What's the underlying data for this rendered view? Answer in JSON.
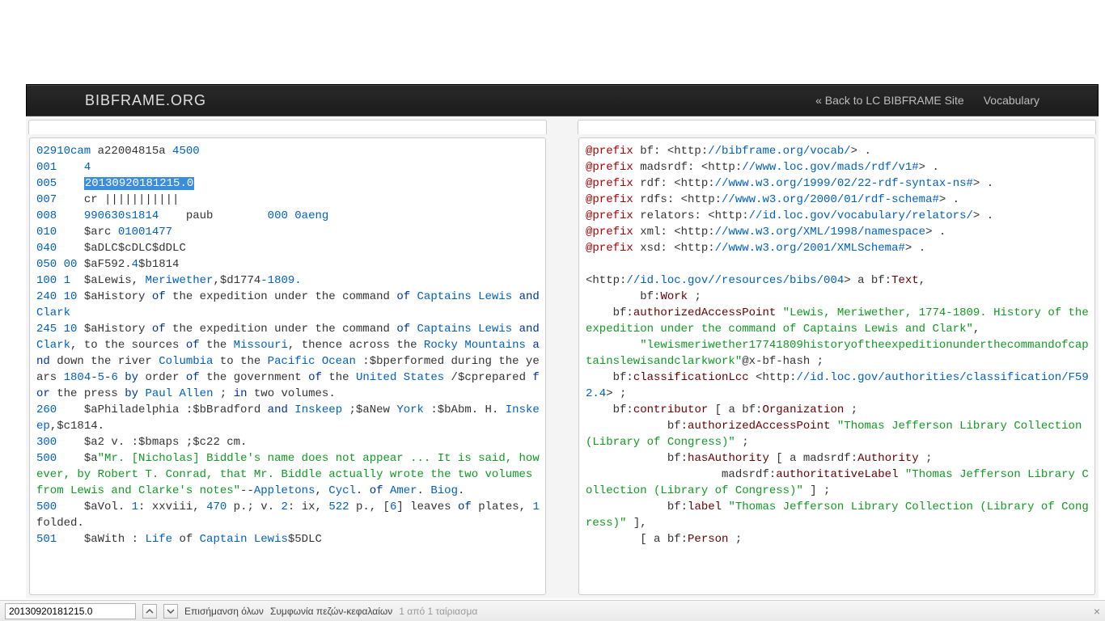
{
  "nav": {
    "brand": "BIBFRAME.ORG",
    "back_link": "« Back to LC BIBFRAME Site",
    "vocab_link": "Vocabulary"
  },
  "findbar": {
    "query": "20130920181215.0",
    "highlight_all": "Επισήμανση όλων",
    "match_case": "Συμφωνία πεζών-κεφαλαίων",
    "result_count": "1 από 1 ταίριασμα"
  },
  "marc": {
    "highlighted": "20130920181215.0",
    "lines": [
      {
        "html": "<span class='tk-blue'>02910cam</span> a22004815a <span class='tk-blue'>4500</span>"
      },
      {
        "html": "<span class='tk-blue'>001</span>    <span class='tk-blue'>4</span>"
      },
      {
        "html": "<span class='tk-blue'>005</span>    <span class='tk-sel'>20130920181215.0</span>"
      },
      {
        "html": "<span class='tk-blue'>007</span>    cr |||||||||||"
      },
      {
        "html": "<span class='tk-blue'>008</span>    <span class='tk-blue'>990630s1814</span>    paub        <span class='tk-blue'>000 0aeng</span>"
      },
      {
        "html": "<span class='tk-blue'>010</span>    $arc <span class='tk-blue'>01001477</span>"
      },
      {
        "html": "<span class='tk-blue'>040</span>    $aDLC$cDLC$dDLC"
      },
      {
        "html": "<span class='tk-blue'>050 00</span> $aF592.<span class='tk-blue'>4</span>$b1814"
      },
      {
        "html": "<span class='tk-blue'>100 1</span>  $aLewis, <span class='tk-comm'>Meriwether</span>,$d1774<span class='tk-blue'>-1809.</span>"
      },
      {
        "html": "<span class='tk-blue'>240 10</span> $aHistory <span class='tk-dblue'>of</span> the expedition under the command <span class='tk-dblue'>of</span> <span class='tk-comm'>Captains Lewis</span> <span class='tk-dblue'>and</span> <span class='tk-comm'>Clark</span>"
      },
      {
        "html": "<span class='tk-blue'>245 10</span> $aHistory <span class='tk-dblue'>of</span> the expedition under the command <span class='tk-dblue'>of</span> <span class='tk-comm'>Captains Lewis</span> <span class='tk-dblue'>and</span> <span class='tk-comm'>Clark</span>, to the sources <span class='tk-dblue'>of</span> the <span class='tk-comm'>Missouri</span>, thence across the <span class='tk-comm'>Rocky Mountains</span> <span class='tk-dblue'>and</span> down the river <span class='tk-comm'>Columbia</span> to the <span class='tk-comm'>Pacific Ocean</span> :$bperformed during the years <span class='tk-blue'>1804</span>-<span class='tk-blue'>5</span>-<span class='tk-blue'>6</span> <span class='tk-dblue'>by</span> order <span class='tk-dblue'>of</span> the government <span class='tk-dblue'>of</span> the <span class='tk-comm'>United States</span> /$cprepared <span class='tk-dblue'>for</span> the press <span class='tk-dblue'>by</span> <span class='tk-comm'>Paul Allen</span> ; <span class='tk-dblue'>in</span> two volumes."
      },
      {
        "html": "<span class='tk-blue'>260</span>    $aPhiladelphia :$bBradford <span class='tk-dblue'>and</span> <span class='tk-comm'>Inskeep</span> ;$aNew <span class='tk-comm'>York</span> :$bAbm. H. <span class='tk-comm'>Inskeep</span>,$c1814."
      },
      {
        "html": "<span class='tk-blue'>300</span>    $a2 v. :$bmaps ;$c22 cm."
      },
      {
        "html": "<span class='tk-blue'>500</span>    $a<span class='tk-green'>\"Mr. [Nicholas] Biddle's name does not appear ... It is said, however, by Robert T. Conrad, that Mr. Biddle actually wrote the two volumes from Lewis and Clarke's notes\"</span>--<span class='tk-comm'>Appletons</span>, <span class='tk-comm'>Cycl</span>. <span class='tk-dblue'>of</span> <span class='tk-comm'>Amer</span>. <span class='tk-comm'>Biog</span>."
      },
      {
        "html": "<span class='tk-blue'>500</span>    $aVol. <span class='tk-blue'>1</span>: xxviii, <span class='tk-blue'>470</span> p.; v. <span class='tk-blue'>2</span>: ix, <span class='tk-blue'>522</span> p., [<span class='tk-blue'>6</span>] leaves <span class='tk-dblue'>of</span> plates, <span class='tk-blue'>1</span> folded."
      },
      {
        "html": "<span class='tk-blue'>501</span>    $aWith : <span class='tk-comm'>Life</span> of <span class='tk-comm'>Captain Lewis</span>$5DLC"
      }
    ]
  },
  "turtle": {
    "lines": [
      {
        "html": "<span class='tk-red'>@prefix</span> bf: &lt;http:<span class='tk-blue'>//bibframe.org/vocab/</span>&gt; ."
      },
      {
        "html": "<span class='tk-red'>@prefix</span> madsrdf: &lt;http:<span class='tk-blue'>//www.loc.gov/mads/rdf/v1#</span>&gt; ."
      },
      {
        "html": "<span class='tk-red'>@prefix</span> rdf: &lt;http:<span class='tk-blue'>//www.w3.org/1999/02/22-rdf-syntax-ns#</span>&gt; ."
      },
      {
        "html": "<span class='tk-red'>@prefix</span> rdfs: &lt;http:<span class='tk-blue'>//www.w3.org/2000/01/rdf-schema#</span>&gt; ."
      },
      {
        "html": "<span class='tk-red'>@prefix</span> relators: &lt;http:<span class='tk-blue'>//id.loc.gov/vocabulary/relators/</span>&gt; ."
      },
      {
        "html": "<span class='tk-red'>@prefix</span> xml: &lt;http:<span class='tk-blue'>//www.w3.org/XML/1998/namespace</span>&gt; ."
      },
      {
        "html": "<span class='tk-red'>@prefix</span> xsd: &lt;http:<span class='tk-blue'>//www.w3.org/2001/XMLSchema#</span>&gt; ."
      },
      {
        "html": ""
      },
      {
        "html": "&lt;http:<span class='tk-blue'>//id.loc.gov//resources/bibs/004</span>&gt; a bf:<span class='tk-field'>Text</span>,"
      },
      {
        "html": "        bf:<span class='tk-field'>Work</span> ;"
      },
      {
        "html": "    bf:<span class='tk-field'>authorizedAccessPoint</span> <span class='tk-green'>\"Lewis, Meriwether, 1774-1809. History of the expedition under the command of Captains Lewis and Clark\"</span>,"
      },
      {
        "html": "        <span class='tk-green'>\"lewismeriwether17741809historyoftheexpeditionunderthecommandofcaptainslewisandclarkwork\"</span>@x-bf-hash ;"
      },
      {
        "html": "    bf:<span class='tk-field'>classificationLcc</span> &lt;http:<span class='tk-blue'>//id.loc.gov/authorities/classification/F592.4</span>&gt; ;"
      },
      {
        "html": "    bf:<span class='tk-field'>contributor</span> [ a bf:<span class='tk-field'>Organization</span> ;"
      },
      {
        "html": "            bf:<span class='tk-field'>authorizedAccessPoint</span> <span class='tk-green'>\"Thomas Jefferson Library Collection (Library of Congress)\"</span> ;"
      },
      {
        "html": "            bf:<span class='tk-field'>hasAuthority</span> [ a madsrdf:<span class='tk-field'>Authority</span> ;"
      },
      {
        "html": "                    madsrdf:<span class='tk-field'>authoritativeLabel</span> <span class='tk-green'>\"Thomas Jefferson Library Collection (Library of Congress)\"</span> ] ;"
      },
      {
        "html": "            bf:<span class='tk-field'>label</span> <span class='tk-green'>\"Thomas Jefferson Library Collection (Library of Congress)\"</span> ],"
      },
      {
        "html": "        [ a bf:<span class='tk-field'>Person</span> ;"
      }
    ]
  }
}
